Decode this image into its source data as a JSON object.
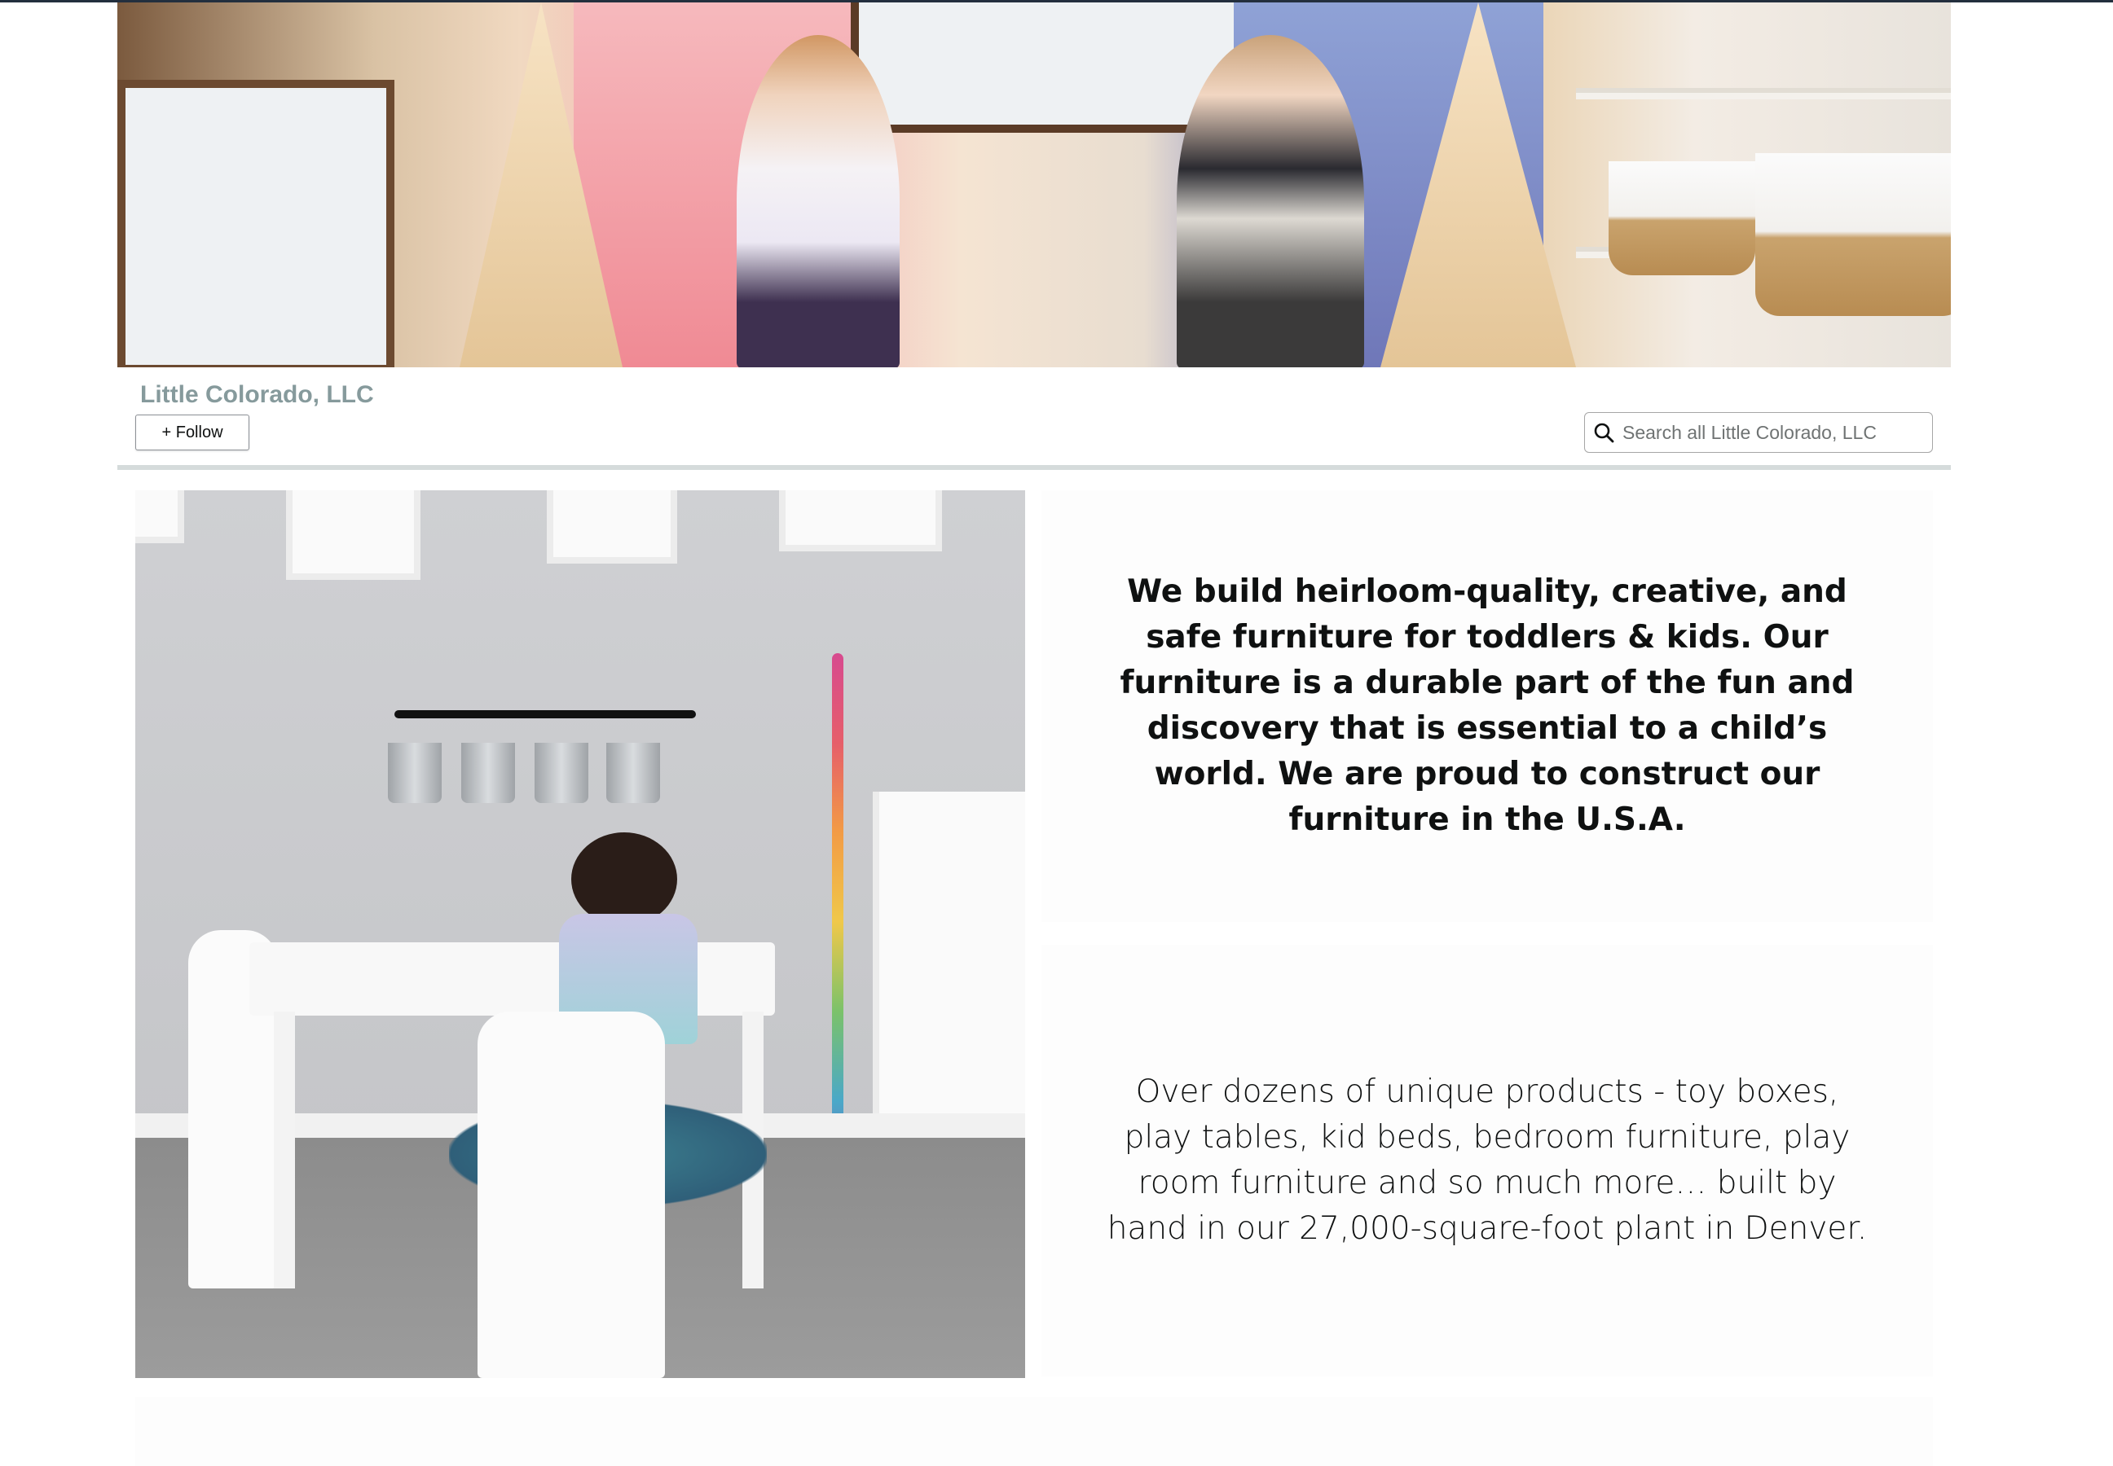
{
  "store": {
    "name": "Little Colorado, LLC",
    "follow_label": "+ Follow",
    "search_placeholder": "Search all Little Colorado, LLC"
  },
  "hero": {
    "alt": "Two children in crowns playing in a wooden climbing play area"
  },
  "feature": {
    "alt": "Girl in a tutu drawing at a white kids table and chair set"
  },
  "content": {
    "tagline": "We build heirloom-quality, creative, and safe furniture for toddlers & kids. Our furniture is a durable part of the fun and discovery that is essential to a child’s world. We are proud to construct our furniture in the U.S.A.",
    "description": "Over dozens of unique products - toy boxes, play tables, kid beds, bedroom furniture, play room furniture and so much more… built by hand in our 27,000-square-foot plant in Denver."
  },
  "colors": {
    "store_name": "#869a9c",
    "divider": "#d5dbdb",
    "text": "#0f1111"
  },
  "icons": {
    "search": "search-icon"
  }
}
